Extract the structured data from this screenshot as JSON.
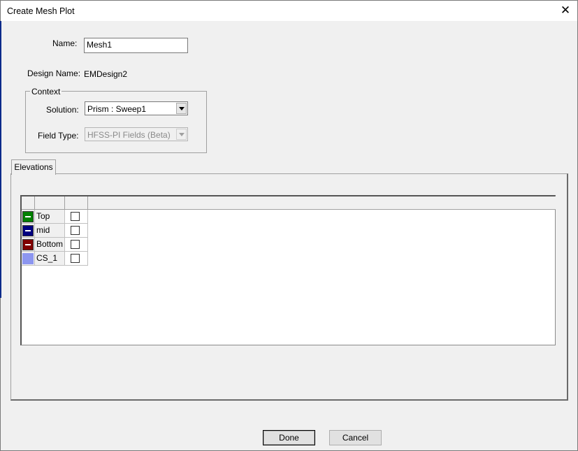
{
  "window": {
    "title": "Create Mesh Plot",
    "close_glyph": "✕"
  },
  "form": {
    "name_label": "Name:",
    "name_value": "Mesh1",
    "design_name_label": "Design Name:",
    "design_name_value": "EMDesign2"
  },
  "context": {
    "legend": "Context",
    "solution_label": "Solution:",
    "solution_value": "Prism : Sweep1",
    "field_type_label": "Field Type:",
    "field_type_value": "HFSS-PI Fields (Beta)"
  },
  "tabs": [
    {
      "label": "Elevations",
      "selected": true
    }
  ],
  "elevations": [
    {
      "name": "Top",
      "color": "#008000",
      "checked": false
    },
    {
      "name": "mid",
      "color": "#000080",
      "checked": false
    },
    {
      "name": "Bottom",
      "color": "#800000",
      "checked": false
    },
    {
      "name": "CS_1",
      "color": "#8c96f0",
      "checked": false
    }
  ],
  "buttons": {
    "done": "Done",
    "cancel": "Cancel"
  }
}
